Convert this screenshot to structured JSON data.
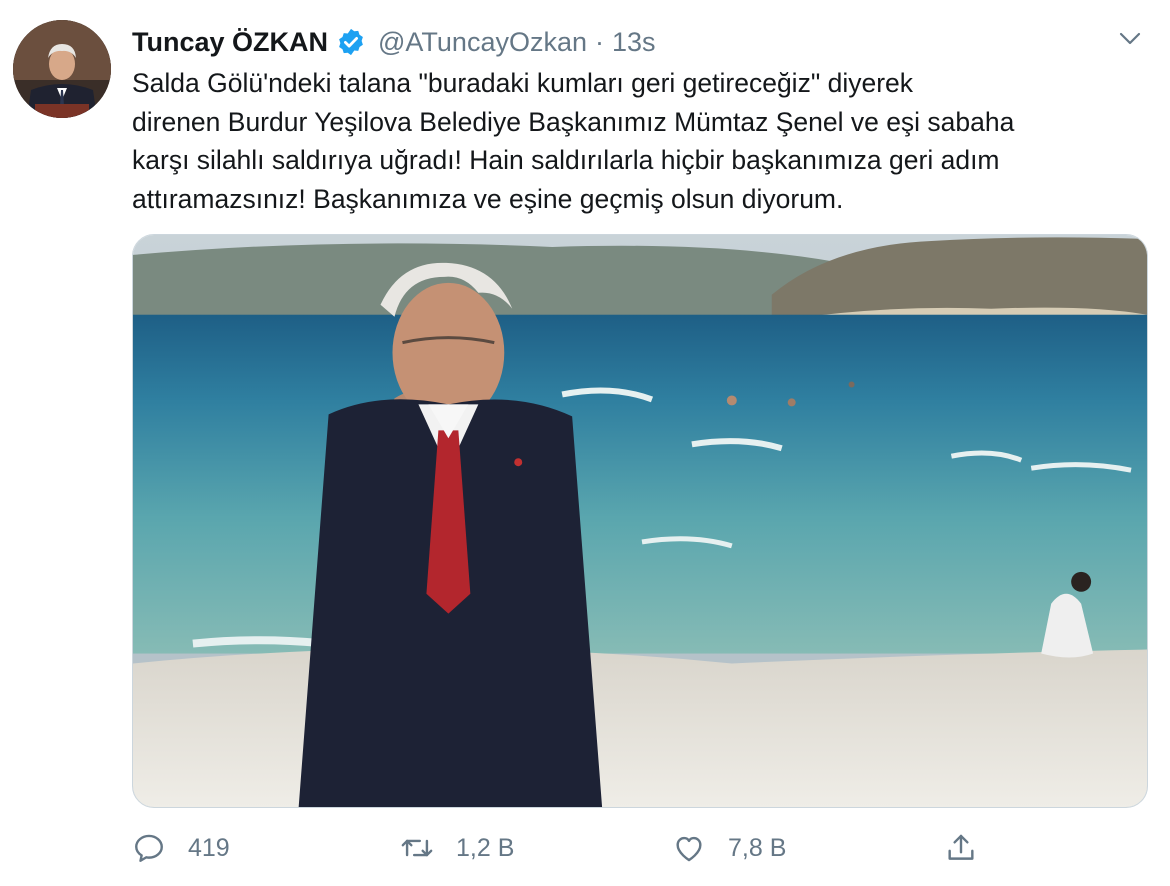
{
  "tweet": {
    "author": {
      "display_name": "Tuncay ÖZKAN",
      "handle": "@ATuncayOzkan",
      "verified": true,
      "avatar_icon": "profile-photo"
    },
    "separator": "·",
    "time": "13s",
    "text": "Salda Gölü'ndeki talana \"buradaki kumları geri getireceğiz\" diyerek\ndirenen Burdur Yeşilova Belediye Başkanımız Mümtaz Şenel ve eşi sabaha\nkarşı silahlı saldırıya uğradı! Hain saldırılarla hiçbir başkanımıza geri adım\nattıramazsınız! Başkanımıza ve eşine geçmiş olsun diyorum.",
    "media": {
      "type": "photo"
    },
    "actions": {
      "reply": {
        "icon": "speech-bubble-icon",
        "count": "419"
      },
      "retweet": {
        "icon": "retweet-icon",
        "count": "1,2 B"
      },
      "like": {
        "icon": "heart-icon",
        "count": "7,8 B"
      },
      "share": {
        "icon": "share-icon"
      }
    }
  },
  "colors": {
    "text_primary": "#14171a",
    "text_secondary": "#657786",
    "verified_blue": "#1da1f2",
    "border": "#ccd6dd"
  }
}
